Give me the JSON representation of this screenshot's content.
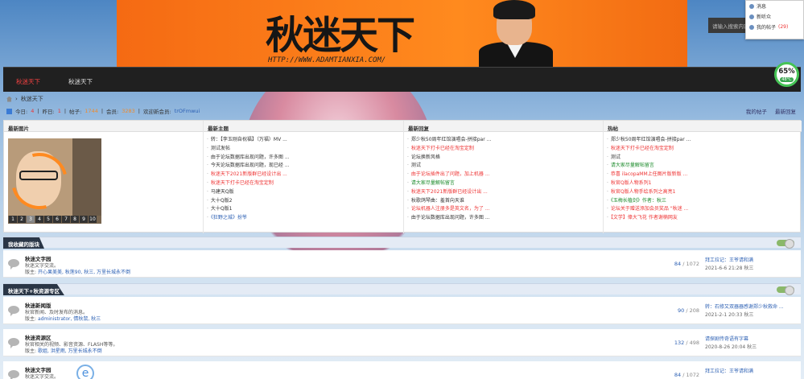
{
  "banner": {
    "logo_text": "秋迷天下",
    "url_text": "HTTP://WWW.ADAMTIANXIA.COM/"
  },
  "search": {
    "placeholder": "请输入搜索内容"
  },
  "user_menu": {
    "items": [
      {
        "label": "消息"
      },
      {
        "label": "新听众"
      },
      {
        "label": "我的帖子",
        "count": "(29)"
      }
    ]
  },
  "nav": {
    "tabs": [
      {
        "label": "秋迷天下",
        "active": true
      },
      {
        "label": "秋迷天下"
      }
    ]
  },
  "gauge": {
    "percent": "65%",
    "temp": "48°C"
  },
  "breadcrumb": {
    "current": "秋迷天下"
  },
  "stats": {
    "today_label": "今日:",
    "today": "4",
    "yesterday_label": "昨日:",
    "yesterday": "1",
    "posts_label": "帖子:",
    "posts": "1744",
    "members_label": "会员:",
    "members": "3283",
    "welcome_label": "欢迎新会员:",
    "newest_member": "trOFmwui",
    "my_posts": "我的帖子",
    "latest_reply": "最新回复"
  },
  "panels": {
    "pic": {
      "title": "最新图片",
      "pages": [
        "1",
        "2",
        "3",
        "4",
        "5",
        "6",
        "7",
        "8",
        "9",
        "10"
      ],
      "current_page": "3"
    },
    "latest_topics": {
      "title": "最新主题",
      "items": [
        {
          "text": "转：【李玉刚自祝福】（万福）MV ..."
        },
        {
          "text": "测试发帖"
        },
        {
          "text": "由于论坛数据库出现问题，许多图 ..."
        },
        {
          "text": "今天论坛数据库出现问题，现已经 ..."
        },
        {
          "text": "秋迷天下2021新版群已经设计出 ...",
          "color": "r"
        },
        {
          "text": "秋迷天下打卡已经在淘宝定制",
          "color": "r"
        },
        {
          "text": "马建天Q版"
        },
        {
          "text": "大十Q版2"
        },
        {
          "text": "大十Q版1"
        },
        {
          "text": "《狂野之城》扮爷",
          "color": "b"
        }
      ]
    },
    "latest_replies": {
      "title": "最新回复",
      "items": [
        {
          "text": "郑少秋50周年红馆演唱会-拼接par ..."
        },
        {
          "text": "秋迷天下打卡已经在淘宝定制",
          "color": "r"
        },
        {
          "text": "论坛换新风格"
        },
        {
          "text": "测试"
        },
        {
          "text": "由于论坛插件出了问题，加上机器 ...",
          "color": "r"
        },
        {
          "text": "请大家尽量解帖留言",
          "color": "g"
        },
        {
          "text": "秋迷天下2021新版群已经设计出 ...",
          "color": "r"
        },
        {
          "text": "秋歌鸽琴曲：羞首向天谁"
        },
        {
          "text": "论坛机器人注册多是英文名，为了 ...",
          "color": "r"
        },
        {
          "text": "由于论坛数据库出现问题，许多图 ..."
        }
      ]
    },
    "hot": {
      "title": "热帖",
      "items": [
        {
          "text": "郑少秋50周年红馆演唱会-拼接par ..."
        },
        {
          "text": "秋迷天下打卡已经在淘宝定制",
          "color": "r"
        },
        {
          "text": "测试"
        },
        {
          "text": "请大家尽量解帖留言",
          "color": "g"
        },
        {
          "text": "恭喜 ilacopaMM上任图片版新版 ...",
          "color": "r"
        },
        {
          "text": "秋官Q版人物系列1",
          "color": "r"
        },
        {
          "text": "秋官Q版人物手绘系列之高亮1",
          "color": "r"
        },
        {
          "text": "《玉梅长植剑》作者：秋三",
          "color": "g"
        },
        {
          "text": "论坛关于赠送添加会员奖品 \"秋迷 ...",
          "color": "r"
        },
        {
          "text": "【文学】偉大飞花 作者谢楠网友",
          "color": "r"
        }
      ]
    }
  },
  "sections": [
    {
      "title": "我收藏的版块",
      "forums": [
        {
          "name": "秋迷文字园",
          "desc": "秋迷文字交流。",
          "mod_label": "版主:",
          "mods": "开心果美美, 秋莲90, 秋三, 万里长城永不倒",
          "threads": "84",
          "posts": "1072",
          "last_title": "拜工拉记：王爷请和满",
          "last_time": "2021-6-6 21:28 秋三"
        }
      ]
    },
    {
      "title": "秋迷天下+秋资源专区",
      "forums": [
        {
          "name": "秋迷新闻版",
          "desc": "秋官新闻、及时发布的消息。",
          "mod_label": "版主:",
          "mods": "administrator, 情秋鼠, 秋三",
          "threads": "90",
          "posts": "208",
          "last_title": "转：石修又双器器感谢郑少秋救命 ...",
          "last_time": "2021-2-1 20:33 秋三"
        },
        {
          "name": "秋迷资源区",
          "desc": "秋官相关的视频、影音资源、FLASH等等。",
          "mod_label": "版主:",
          "mods": "歌姐, 洪星雨, 万里长城永不倒",
          "threads": "132",
          "posts": "498",
          "last_title": "请探剧传奇语有字幕",
          "last_time": "2020-8-26 20:04 秋三"
        },
        {
          "name": "秋迷文字园",
          "desc": "秋迷文字交流。",
          "mod_label": "版主:",
          "mods": "",
          "threads": "84",
          "posts": "1072",
          "last_title": "拜工拉记：王爷请和满",
          "last_time": ""
        }
      ]
    }
  ]
}
